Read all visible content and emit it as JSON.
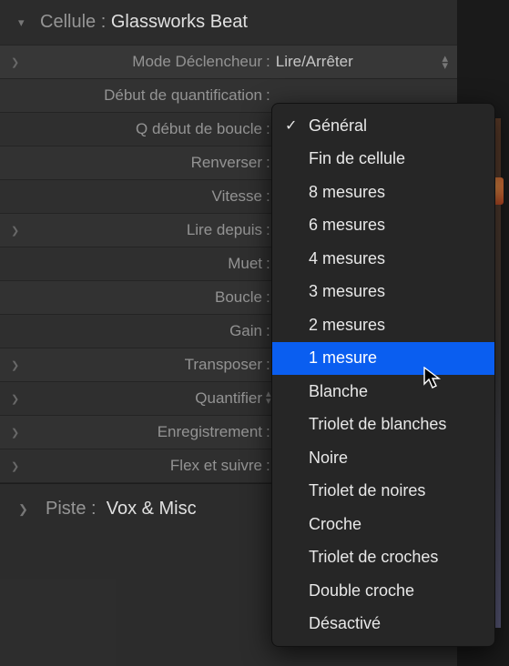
{
  "header": {
    "prefix": "Cellule :",
    "value": "Glassworks Beat"
  },
  "rows": [
    {
      "expander": true,
      "label": "Mode Déclencheur",
      "value": "Lire/Arrêter",
      "selectArrows": true,
      "highlight": true
    },
    {
      "expander": false,
      "label": "Début de quantification",
      "value": ""
    },
    {
      "expander": false,
      "label": "Q début de boucle",
      "value": ""
    },
    {
      "expander": false,
      "label": "Renverser",
      "value": ""
    },
    {
      "expander": false,
      "label": "Vitesse",
      "value": ""
    },
    {
      "expander": true,
      "label": "Lire depuis",
      "value": ""
    },
    {
      "expander": false,
      "label": "Muet",
      "value": ""
    },
    {
      "expander": false,
      "label": "Boucle",
      "value": ""
    },
    {
      "expander": false,
      "label": "Gain",
      "value": ""
    },
    {
      "expander": true,
      "label": "Transposer",
      "value": ""
    },
    {
      "expander": true,
      "label": "Quantifier",
      "value": "",
      "smallArrows": true
    },
    {
      "expander": true,
      "label": "Enregistrement",
      "value": ""
    },
    {
      "expander": true,
      "label": "Flex et suivre",
      "value": ""
    }
  ],
  "track": {
    "prefix": "Piste :",
    "value": "Vox & Misc"
  },
  "dropdown": {
    "items": [
      {
        "label": "Général",
        "checked": true,
        "selected": false
      },
      {
        "label": "Fin de cellule",
        "checked": false,
        "selected": false
      },
      {
        "label": "8 mesures",
        "checked": false,
        "selected": false
      },
      {
        "label": "6 mesures",
        "checked": false,
        "selected": false
      },
      {
        "label": "4 mesures",
        "checked": false,
        "selected": false
      },
      {
        "label": "3 mesures",
        "checked": false,
        "selected": false
      },
      {
        "label": "2 mesures",
        "checked": false,
        "selected": false
      },
      {
        "label": "1 mesure",
        "checked": false,
        "selected": true
      },
      {
        "label": "Blanche",
        "checked": false,
        "selected": false
      },
      {
        "label": "Triolet de blanches",
        "checked": false,
        "selected": false
      },
      {
        "label": "Noire",
        "checked": false,
        "selected": false
      },
      {
        "label": "Triolet de noires",
        "checked": false,
        "selected": false
      },
      {
        "label": "Croche",
        "checked": false,
        "selected": false
      },
      {
        "label": "Triolet de croches",
        "checked": false,
        "selected": false
      },
      {
        "label": "Double croche",
        "checked": false,
        "selected": false
      },
      {
        "label": "Désactivé",
        "checked": false,
        "selected": false
      }
    ]
  }
}
